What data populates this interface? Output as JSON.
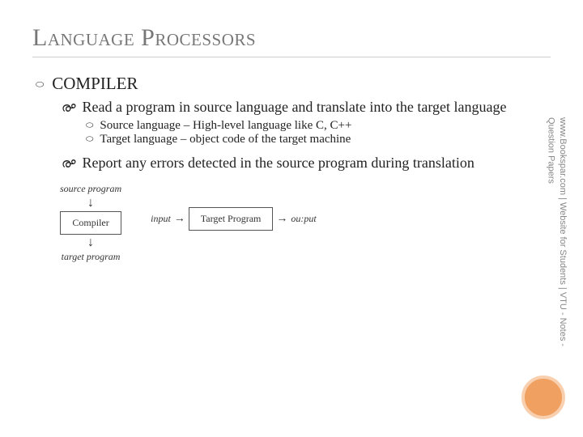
{
  "title": "Language Processors",
  "section": "COMPILER",
  "bullets": {
    "b1": "Read a program in source language and translate into the target language",
    "b1a": "Source language – High-level language like C, C++",
    "b1b": "Target language – object code of the target machine",
    "b2": "Report any errors detected in the source program during translation"
  },
  "diagram1": {
    "top": "source program",
    "box": "Compiler",
    "bottom": "target program"
  },
  "diagram2": {
    "left": "input",
    "box": "Target Program",
    "right": "ou:put"
  },
  "sidebar": "www.Bookspar.com | Website for Students | VTU - Notes - Question Papers",
  "glyphs": {
    "ring": "⬭",
    "swirl": "൙",
    "hollow": "○",
    "down": "↓",
    "right": "→"
  }
}
